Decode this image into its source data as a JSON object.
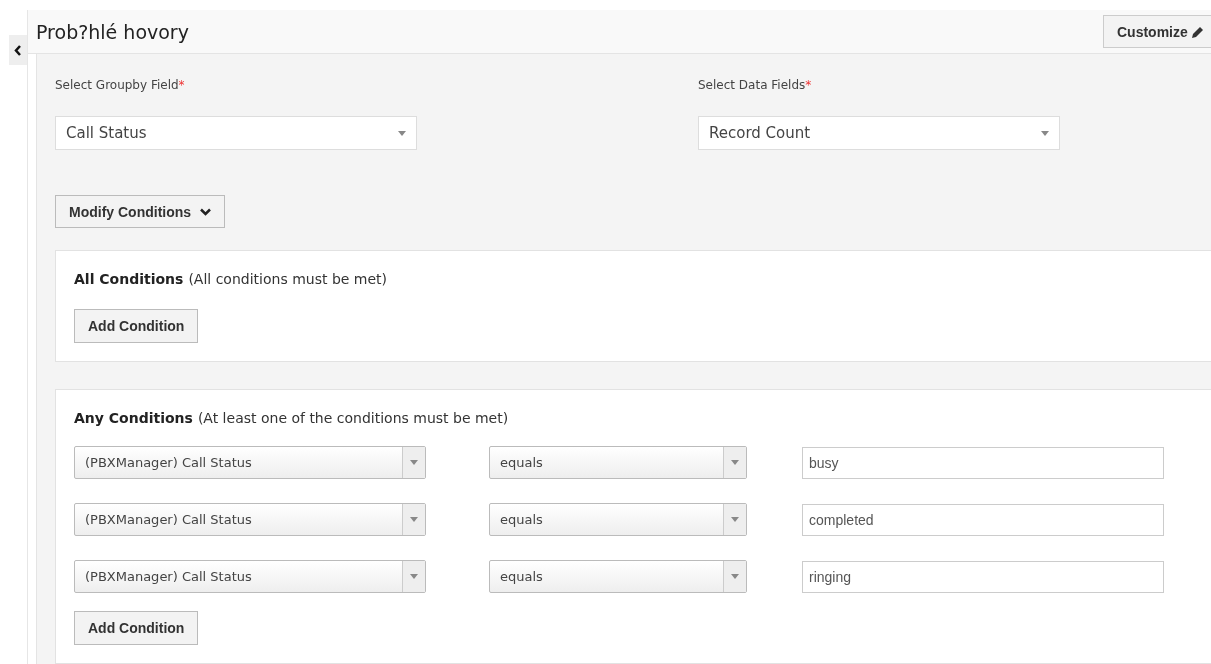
{
  "title": "Prob?hlé hovory",
  "customize_button": {
    "label": "Customize"
  },
  "groupby": {
    "label": "Select Groupby Field",
    "required_mark": "*",
    "value": "Call Status"
  },
  "data_fields": {
    "label": "Select Data Fields",
    "required_mark": "*",
    "value": "Record Count"
  },
  "modify_button": {
    "label": "Modify Conditions"
  },
  "all_conditions": {
    "title": "All Conditions",
    "hint": "(All conditions must be met)",
    "add_button": "Add Condition"
  },
  "any_conditions": {
    "title": "Any Conditions",
    "hint": "(At least one of the conditions must be met)",
    "add_button": "Add Condition",
    "rows": [
      {
        "field": "(PBXManager) Call Status",
        "operator": "equals",
        "value": "busy"
      },
      {
        "field": "(PBXManager) Call Status",
        "operator": "equals",
        "value": "completed"
      },
      {
        "field": "(PBXManager) Call Status",
        "operator": "equals",
        "value": "ringing"
      }
    ]
  }
}
